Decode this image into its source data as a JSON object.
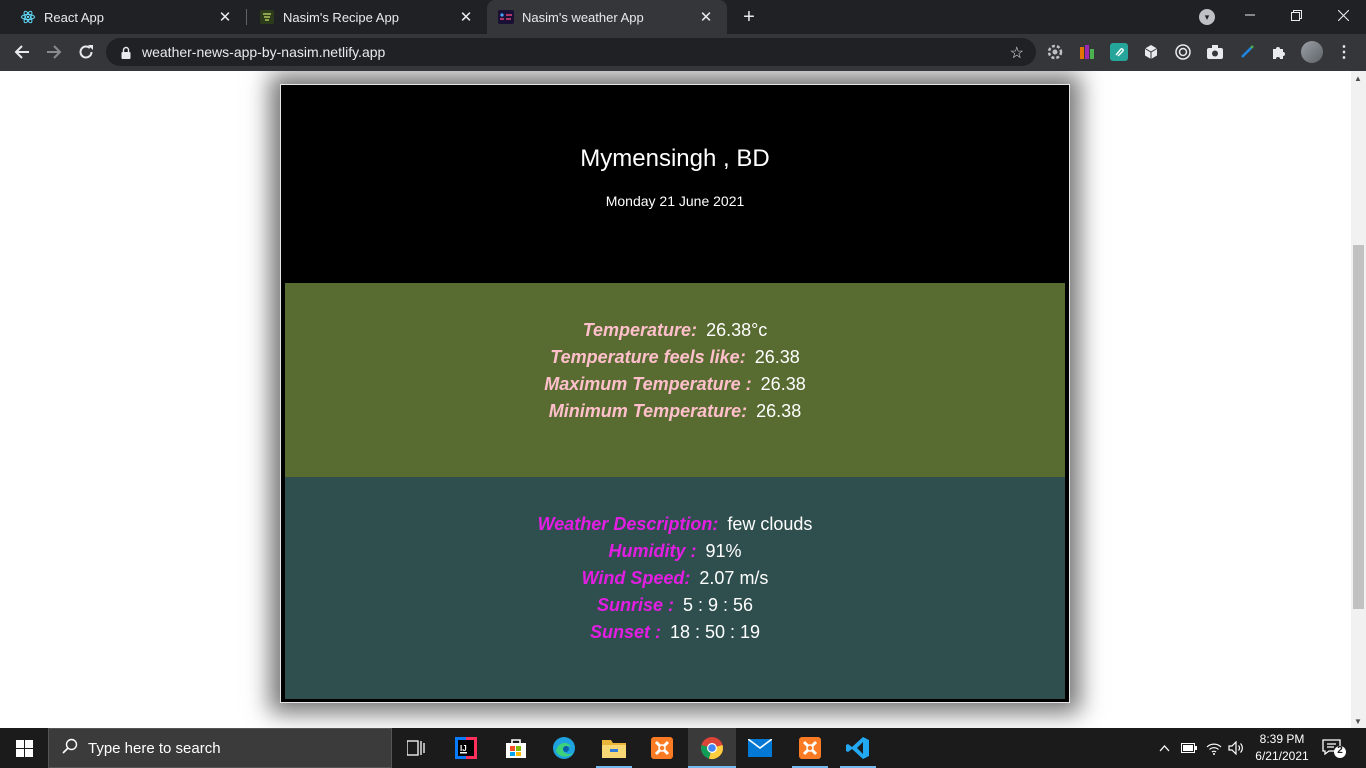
{
  "browser": {
    "tabs": [
      {
        "title": "React App",
        "icon": "react-icon",
        "active": false
      },
      {
        "title": "Nasim's Recipe App",
        "icon": "recipe-icon",
        "active": false
      },
      {
        "title": "Nasim's weather App",
        "icon": "weather-icon",
        "active": true
      }
    ],
    "address": "weather-news-app-by-nasim.netlify.app"
  },
  "page": {
    "city": "Mymensingh , BD",
    "date": "Monday 21 June 2021",
    "temperature": [
      {
        "label": "Temperature:",
        "value": "26.38°c"
      },
      {
        "label": "Temperature feels like:",
        "value": "26.38"
      },
      {
        "label": "Maximum Temperature :",
        "value": "26.38"
      },
      {
        "label": "Minimum Temperature:",
        "value": "26.38"
      }
    ],
    "details": [
      {
        "label": "Weather Description:",
        "value": "few clouds"
      },
      {
        "label": "Humidity :",
        "value": "91%"
      },
      {
        "label": "Wind Speed:",
        "value": "2.07 m/s"
      },
      {
        "label": "Sunrise :",
        "value": "5 : 9 : 56"
      },
      {
        "label": "Sunset :",
        "value": "18 : 50 : 19"
      }
    ],
    "colors": {
      "temp_panel": "#586b31",
      "info_panel": "#2f4f4f",
      "temp_label": "#ffc0cb",
      "info_label": "#e21ee2"
    }
  },
  "taskbar": {
    "search_placeholder": "Type here to search",
    "time": "8:39 PM",
    "date": "6/21/2021",
    "notifications": "2"
  }
}
